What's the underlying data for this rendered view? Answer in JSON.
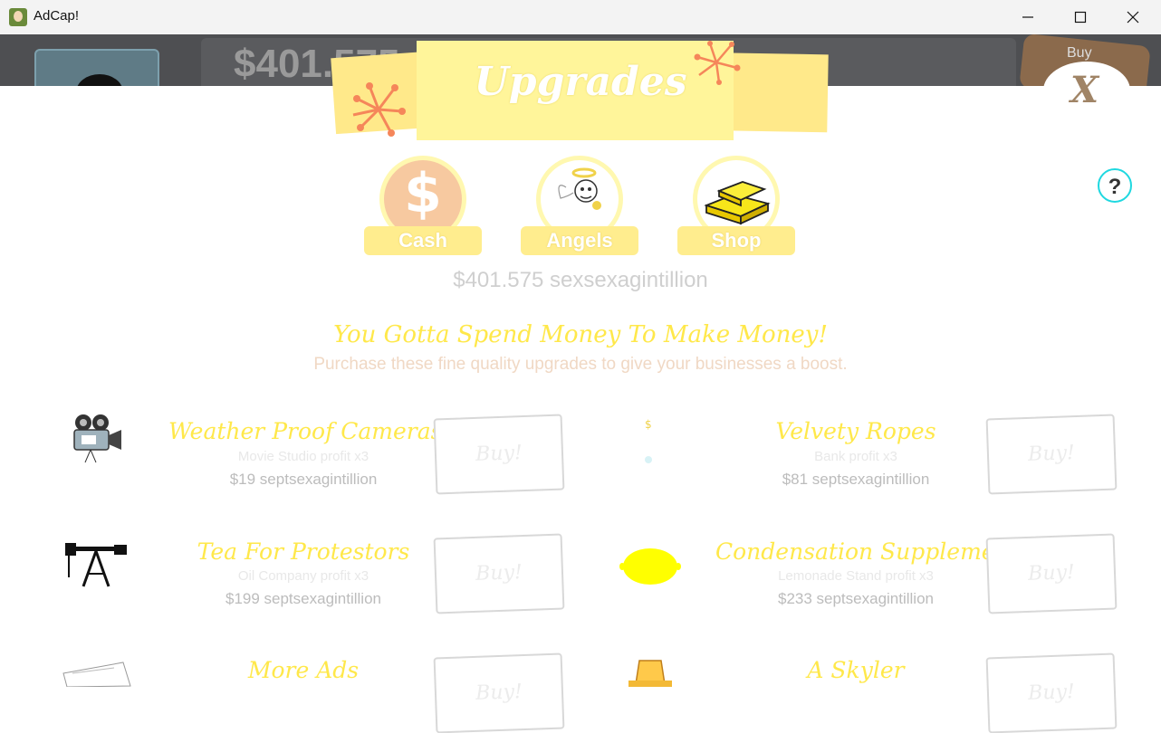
{
  "window": {
    "title": "AdCap!"
  },
  "backdrop": {
    "money_text": "$401.575",
    "buy_text": "Buy"
  },
  "modal": {
    "title": "Upgrades",
    "close_label": "X",
    "help_label": "?",
    "tabs": [
      {
        "label": "Cash",
        "icon": "dollar-icon"
      },
      {
        "label": "Angels",
        "icon": "angel-icon"
      },
      {
        "label": "Shop",
        "icon": "gold-bars-icon"
      }
    ],
    "money": "$401.575 sexsexagintillion",
    "headline": "You Gotta Spend Money To Make Money!",
    "subheadline": "Purchase these fine quality upgrades to give your businesses a boost.",
    "buy_label": "Buy!",
    "upgrades": [
      {
        "name": "Weather Proof Cameras",
        "desc": "Movie Studio profit x3",
        "cost": "$19 septsexagintillion",
        "icon": "movie-camera-icon"
      },
      {
        "name": "Velvety Ropes",
        "desc": "Bank profit x3",
        "cost": "$81 septsexagintillion",
        "icon": "bank-icon"
      },
      {
        "name": "Tea For Protestors",
        "desc": "Oil Company profit x3",
        "cost": "$199 septsexagintillion",
        "icon": "oil-pump-icon"
      },
      {
        "name": "Condensation Supplements",
        "desc": "Lemonade Stand profit x3",
        "cost": "$233 septsexagintillion",
        "icon": "lemon-icon"
      },
      {
        "name": "More Ads",
        "desc": "",
        "cost": "",
        "icon": "newspaper-icon"
      },
      {
        "name": "A Skyler",
        "desc": "",
        "cost": "",
        "icon": "car-icon"
      }
    ]
  }
}
